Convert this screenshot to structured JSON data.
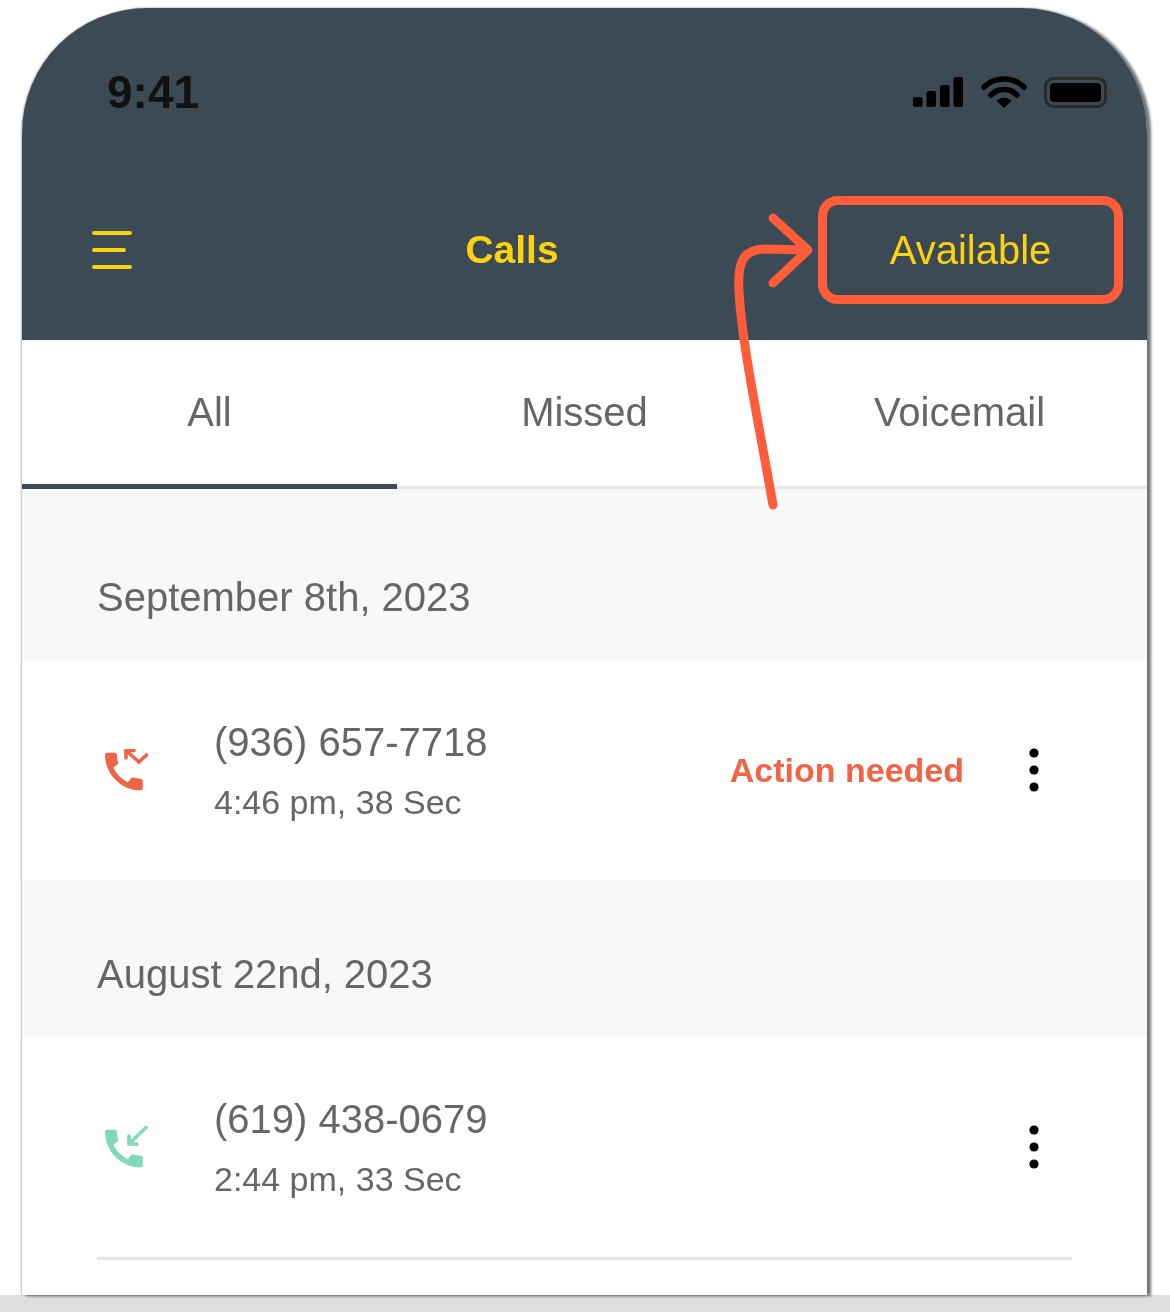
{
  "status_bar": {
    "time": "9:41"
  },
  "header": {
    "title": "Calls",
    "status_button": {
      "label": "Available",
      "highlighted": true
    }
  },
  "tabs": [
    {
      "label": "All",
      "selected": true
    },
    {
      "label": "Missed",
      "selected": false
    },
    {
      "label": "Voicemail",
      "selected": false
    }
  ],
  "call_groups": [
    {
      "date": "September 8th, 2023",
      "calls": [
        {
          "kind": "missed",
          "number": "(936) 657-7718",
          "details": "4:46 pm, 38 Sec",
          "status": "Action needed"
        }
      ]
    },
    {
      "date": "August 22nd, 2023",
      "calls": [
        {
          "kind": "incoming",
          "number": "(619) 438-0679",
          "details": "2:44 pm, 33 Sec"
        }
      ]
    }
  ]
}
